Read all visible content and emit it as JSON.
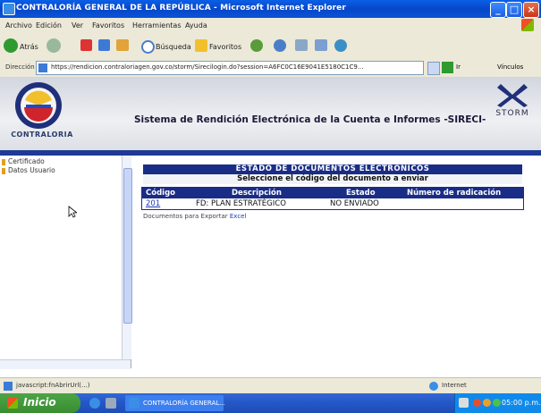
{
  "window": {
    "title": "CONTRALORÍA GENERAL DE LA REPÚBLICA - Microsoft Internet Explorer"
  },
  "menu": [
    "Archivo",
    "Edición",
    "Ver",
    "Favoritos",
    "Herramientas",
    "Ayuda"
  ],
  "toolbar": {
    "back": "Atrás",
    "search": "Búsqueda",
    "favorites": "Favoritos"
  },
  "address": {
    "label": "Dirección",
    "url": "https://rendicion.contraloriagen.gov.co/storm/Sirecilogin.do?session=A6FC0C16E9041E5180C1C9...",
    "go": "Ir",
    "links": "Vínculos"
  },
  "banner": {
    "title": "Sistema de Rendición Electrónica de la Cuenta e Informes -SIRECI-",
    "logo_text": "CONTRALORIA",
    "storm_text": "STORM"
  },
  "nav": {
    "items": [
      "Certificado",
      "Datos Usuario"
    ]
  },
  "content": {
    "header": "ESTADO DE DOCUMENTOS ELECTRÓNICOS",
    "subheader": "Seleccione el código del documento a enviar",
    "table": {
      "columns": [
        "Código",
        "Descripción",
        "Estado",
        "Número de radicación"
      ],
      "rows": [
        {
          "code": "201",
          "description": "FD: PLAN ESTRATÉGICO",
          "status": "NO ENVIADO",
          "radicacion": ""
        }
      ]
    },
    "note_prefix": "Documentos para Exportar",
    "note_link": "Excel"
  },
  "status": {
    "text": "javascript:fnAbrirUrl(...)",
    "zone": "Internet"
  },
  "taskbar": {
    "start": "Inicio",
    "task": "CONTRALORÍA GENERAL...",
    "clock": "05:00 p.m."
  }
}
